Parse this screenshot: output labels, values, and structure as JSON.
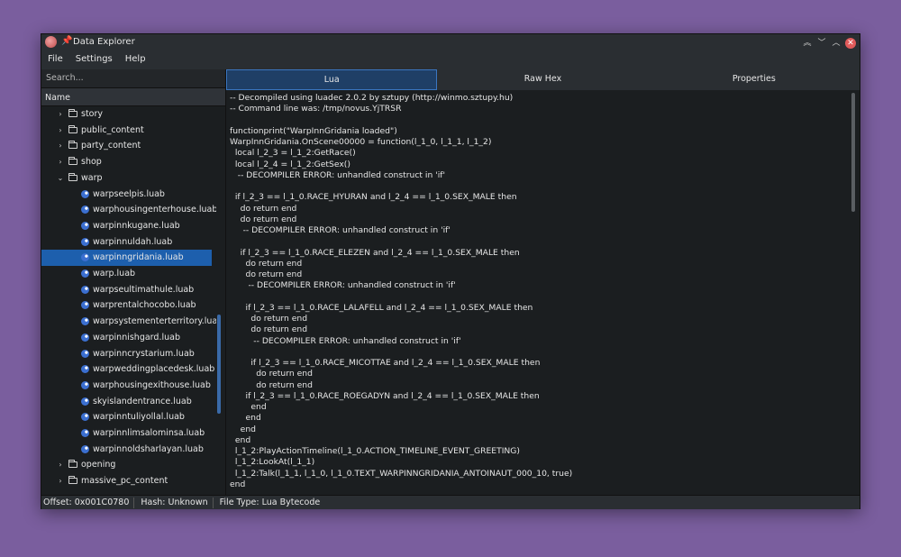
{
  "window": {
    "title": "Data Explorer",
    "controls": [
      "︽",
      "﹀",
      "︿",
      "✕"
    ]
  },
  "menu": [
    "File",
    "Settings",
    "Help"
  ],
  "search": {
    "placeholder": "Search..."
  },
  "tree": {
    "header": "Name",
    "items": [
      {
        "label": "story",
        "type": "folder",
        "expanded": false,
        "depth": 1
      },
      {
        "label": "public_content",
        "type": "folder",
        "expanded": false,
        "depth": 1
      },
      {
        "label": "party_content",
        "type": "folder",
        "expanded": false,
        "depth": 1
      },
      {
        "label": "shop",
        "type": "folder",
        "expanded": false,
        "depth": 1
      },
      {
        "label": "warp",
        "type": "folder",
        "expanded": true,
        "depth": 1
      },
      {
        "label": "warpseelpis.luab",
        "type": "file",
        "depth": 2
      },
      {
        "label": "warphousingenterhouse.luab",
        "type": "file",
        "depth": 2
      },
      {
        "label": "warpinnkugane.luab",
        "type": "file",
        "depth": 2
      },
      {
        "label": "warpinnuldah.luab",
        "type": "file",
        "depth": 2
      },
      {
        "label": "warpinngridania.luab",
        "type": "file",
        "depth": 2,
        "selected": true
      },
      {
        "label": "warp.luab",
        "type": "file",
        "depth": 2
      },
      {
        "label": "warpseultimathule.luab",
        "type": "file",
        "depth": 2
      },
      {
        "label": "warprentalchocobo.luab",
        "type": "file",
        "depth": 2
      },
      {
        "label": "warpsystementerterritory.luab",
        "type": "file",
        "depth": 2
      },
      {
        "label": "warpinnishgard.luab",
        "type": "file",
        "depth": 2
      },
      {
        "label": "warpinncrystarium.luab",
        "type": "file",
        "depth": 2
      },
      {
        "label": "warpweddingplacedesk.luab",
        "type": "file",
        "depth": 2
      },
      {
        "label": "warphousingexithouse.luab",
        "type": "file",
        "depth": 2
      },
      {
        "label": "skyislandentrance.luab",
        "type": "file",
        "depth": 2
      },
      {
        "label": "warpinntuliyollal.luab",
        "type": "file",
        "depth": 2
      },
      {
        "label": "warpinnlimsalominsa.luab",
        "type": "file",
        "depth": 2
      },
      {
        "label": "warpinnoldsharlayan.luab",
        "type": "file",
        "depth": 2
      },
      {
        "label": "opening",
        "type": "folder",
        "expanded": false,
        "depth": 1
      },
      {
        "label": "massive_pc_content",
        "type": "folder",
        "expanded": false,
        "depth": 1
      }
    ]
  },
  "tabs": [
    {
      "label": "Lua",
      "active": true
    },
    {
      "label": "Raw Hex",
      "active": false
    },
    {
      "label": "Properties",
      "active": false
    }
  ],
  "code_lines": [
    "-- Decompiled using luadec 2.0.2 by sztupy (http://winmo.sztupy.hu)",
    "-- Command line was: /tmp/novus.YjTRSR",
    "",
    "functionprint(\"WarpInnGridania loaded\")",
    "WarpInnGridania.OnScene00000 = function(l_1_0, l_1_1, l_1_2)",
    "  local l_2_3 = l_1_2:GetRace()",
    "  local l_2_4 = l_1_2:GetSex()",
    "   -- DECOMPILER ERROR: unhandled construct in 'if'",
    "",
    "  if l_2_3 == l_1_0.RACE_HYURAN and l_2_4 == l_1_0.SEX_MALE then",
    "    do return end",
    "    do return end",
    "     -- DECOMPILER ERROR: unhandled construct in 'if'",
    "",
    "    if l_2_3 == l_1_0.RACE_ELEZEN and l_2_4 == l_1_0.SEX_MALE then",
    "      do return end",
    "      do return end",
    "       -- DECOMPILER ERROR: unhandled construct in 'if'",
    "",
    "      if l_2_3 == l_1_0.RACE_LALAFELL and l_2_4 == l_1_0.SEX_MALE then",
    "        do return end",
    "        do return end",
    "         -- DECOMPILER ERROR: unhandled construct in 'if'",
    "",
    "        if l_2_3 == l_1_0.RACE_MICOTTAE and l_2_4 == l_1_0.SEX_MALE then",
    "          do return end",
    "          do return end",
    "      if l_2_3 == l_1_0.RACE_ROEGADYN and l_2_4 == l_1_0.SEX_MALE then",
    "        end",
    "      end",
    "    end",
    "  end",
    "  l_1_2:PlayActionTimeline(l_1_0.ACTION_TIMELINE_EVENT_GREETING)",
    "  l_1_2:LookAt(l_1_1)",
    "  l_1_2:Talk(l_1_1, l_1_0, l_1_0.TEXT_WARPINNGRIDANIA_ANTOINAUT_000_10, true)",
    "end"
  ],
  "status": {
    "offset": "Offset: 0x001C0780",
    "hash": "Hash: Unknown",
    "file_type": "File Type: Lua Bytecode"
  },
  "tree_scroll_fraction": 0.72
}
